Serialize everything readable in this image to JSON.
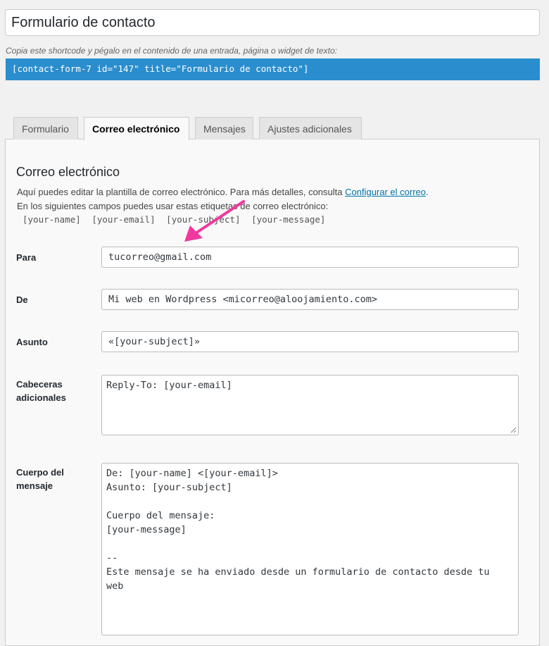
{
  "form_title": "Formulario de contacto",
  "shortcode_hint": "Copia este shortcode y pégalo en el contenido de una entrada, página o widget de texto:",
  "shortcode": "[contact-form-7 id=\"147\" title=\"Formulario de contacto\"]",
  "tabs": [
    {
      "label": "Formulario"
    },
    {
      "label": "Correo electrónico"
    },
    {
      "label": "Mensajes"
    },
    {
      "label": "Ajustes adicionales"
    }
  ],
  "section": {
    "title": "Correo electrónico",
    "desc1": "Aquí puedes editar la plantilla de correo electrónico. Para más detalles, consulta ",
    "desc1_link": "Configurar el correo",
    "desc1_end": ".",
    "desc2": "En los siguientes campos puedes usar estas etiquetas de correo electrónico:",
    "mail_tags": [
      "[your-name]",
      "[your-email]",
      "[your-subject]",
      "[your-message]"
    ]
  },
  "fields": {
    "para": {
      "label": "Para",
      "value": "tucorreo@gmail.com"
    },
    "de": {
      "label": "De",
      "value": "Mi web en Wordpress <micorreo@aloojamiento.com>"
    },
    "asunto": {
      "label": "Asunto",
      "value": "«[your-subject]»"
    },
    "cabeceras": {
      "label_1": "Cabeceras",
      "label_2": "adicionales",
      "value": "Reply-To: [your-email]"
    },
    "cuerpo": {
      "label_1": "Cuerpo del",
      "label_2": "mensaje",
      "lines": [
        "De: [your-name] <[your-email]>",
        "Asunto: [your-subject]",
        "",
        "Cuerpo del mensaje:",
        "[your-message]",
        "",
        "--",
        "Este mensaje se ha enviado desde un formulario de contacto desde tu",
        "web"
      ]
    }
  },
  "colors": {
    "accent": "#2a8ece",
    "annotation_arrow": "#f0399e",
    "link": "#0073aa"
  }
}
